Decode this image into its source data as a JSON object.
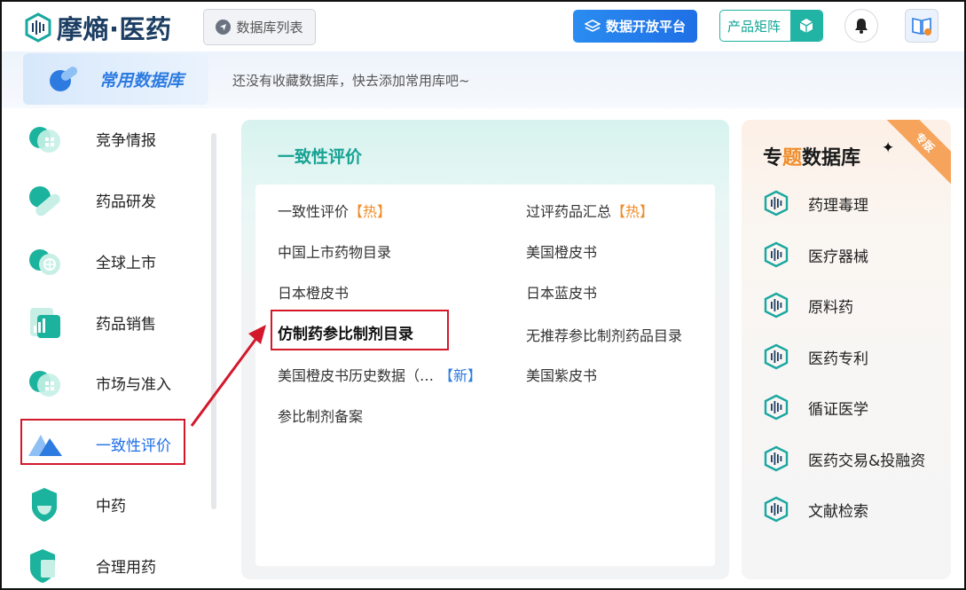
{
  "header": {
    "logo_text": "摩熵·医药",
    "db_list_label": "数据库列表",
    "open_platform_label": "数据开放平台",
    "product_matrix_label": "产品矩阵"
  },
  "favorites": {
    "title": "常用数据库",
    "empty_text": "还没有收藏数据库，快去添加常用库吧~"
  },
  "sidebar": {
    "items": [
      {
        "label": "竞争情报"
      },
      {
        "label": "药品研发"
      },
      {
        "label": "全球上市"
      },
      {
        "label": "药品销售"
      },
      {
        "label": "市场与准入"
      },
      {
        "label": "一致性评价"
      },
      {
        "label": "中药"
      },
      {
        "label": "合理用药"
      }
    ]
  },
  "main": {
    "title": "一致性评价",
    "left_col": [
      {
        "label": "一致性评价",
        "badge": "【热】"
      },
      {
        "label": "中国上市药物目录"
      },
      {
        "label": "日本橙皮书"
      },
      {
        "label": "仿制药参比制剂目录"
      },
      {
        "label": "美国橙皮书历史数据（…",
        "badge": "【新】"
      },
      {
        "label": "参比制剂备案"
      }
    ],
    "right_col": [
      {
        "label": "过评药品汇总",
        "badge": "【热】"
      },
      {
        "label": "美国橙皮书"
      },
      {
        "label": "日本蓝皮书"
      },
      {
        "label": "无推荐参比制剂药品目录"
      },
      {
        "label": "美国紫皮书"
      }
    ]
  },
  "topics": {
    "ribbon": "专版",
    "title_a": "专",
    "title_b": "题",
    "title_c": "数据库",
    "items": [
      {
        "label": "药理毒理"
      },
      {
        "label": "医疗器械"
      },
      {
        "label": "原料药"
      },
      {
        "label": "医药专利"
      },
      {
        "label": "循证医学"
      },
      {
        "label": "医药交易&投融资"
      },
      {
        "label": "文献检索"
      }
    ]
  },
  "colors": {
    "accent_blue": "#1f6fe6",
    "accent_teal": "#17a293",
    "hot_orange": "#f08c2a",
    "highlight_red": "#d3182a"
  }
}
